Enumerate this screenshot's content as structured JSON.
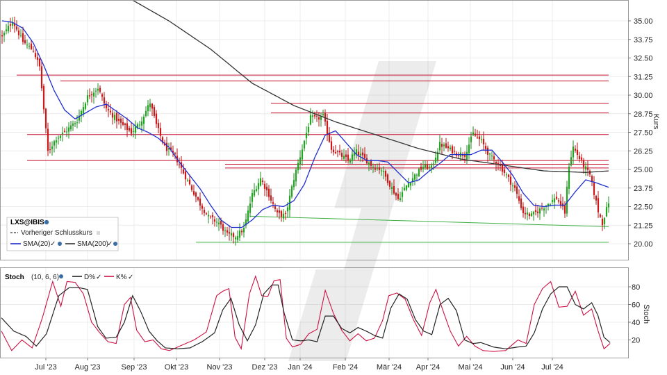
{
  "chart_data": [
    {
      "type": "candlestick",
      "symbol": "LXS@IBIS",
      "ylabel": "Kurs",
      "ylim": [
        19.2,
        35.9
      ],
      "yticks": [
        "35.00",
        "33.75",
        "32.50",
        "31.25",
        "30.00",
        "28.75",
        "27.50",
        "26.25",
        "25.00",
        "23.75",
        "22.50",
        "21.25",
        "20.00"
      ],
      "xticks": [
        "Jul '23",
        "Aug '23",
        "Sep '23",
        "Okt '23",
        "Nov '23",
        "Dez '23",
        "Jan '24",
        "Feb '24",
        "Mär '24",
        "Apr '24",
        "Mai '24",
        "Jun '24",
        "Jul '24"
      ],
      "legend": {
        "symbol": "LXS@IBIS",
        "prev_close": "Vorheriger Schlusskurs",
        "sma20": "SMA(20)",
        "sma200": "SMA(200)"
      },
      "close_anchors": [
        [
          0,
          33.9
        ],
        [
          5,
          35.0
        ],
        [
          10,
          33.6
        ],
        [
          15,
          33.0
        ],
        [
          18,
          31.9
        ],
        [
          22,
          26.2
        ],
        [
          26,
          27.1
        ],
        [
          30,
          27.5
        ],
        [
          36,
          28.3
        ],
        [
          41,
          29.9
        ],
        [
          46,
          30.5
        ],
        [
          50,
          29.1
        ],
        [
          56,
          28.2
        ],
        [
          62,
          27.5
        ],
        [
          66,
          28.1
        ],
        [
          71,
          29.5
        ],
        [
          74,
          28.0
        ],
        [
          78,
          26.5
        ],
        [
          83,
          25.9
        ],
        [
          88,
          24.5
        ],
        [
          94,
          22.9
        ],
        [
          99,
          21.8
        ],
        [
          104,
          21.4
        ],
        [
          108,
          20.6
        ],
        [
          112,
          20.5
        ],
        [
          116,
          21.0
        ],
        [
          120,
          23.3
        ],
        [
          124,
          24.4
        ],
        [
          128,
          23.3
        ],
        [
          132,
          22.0
        ],
        [
          136,
          21.9
        ],
        [
          140,
          24.4
        ],
        [
          144,
          26.4
        ],
        [
          148,
          28.5
        ],
        [
          151,
          28.4
        ],
        [
          154,
          28.6
        ],
        [
          158,
          26.4
        ],
        [
          162,
          26.0
        ],
        [
          166,
          25.6
        ],
        [
          170,
          26.2
        ],
        [
          174,
          25.7
        ],
        [
          178,
          25.2
        ],
        [
          182,
          25.0
        ],
        [
          186,
          24.0
        ],
        [
          190,
          23.0
        ],
        [
          194,
          23.9
        ],
        [
          198,
          24.6
        ],
        [
          202,
          25.2
        ],
        [
          206,
          25.1
        ],
        [
          210,
          26.7
        ],
        [
          214,
          26.4
        ],
        [
          218,
          26.1
        ],
        [
          222,
          26.0
        ],
        [
          226,
          27.4
        ],
        [
          230,
          26.9
        ],
        [
          234,
          25.9
        ],
        [
          238,
          25.4
        ],
        [
          242,
          24.6
        ],
        [
          246,
          23.7
        ],
        [
          250,
          22.1
        ],
        [
          254,
          21.9
        ],
        [
          258,
          22.3
        ],
        [
          262,
          22.7
        ],
        [
          266,
          23.1
        ],
        [
          270,
          22.1
        ],
        [
          272,
          25.3
        ],
        [
          274,
          26.5
        ],
        [
          278,
          25.5
        ],
        [
          282,
          24.6
        ],
        [
          286,
          22.2
        ],
        [
          288,
          21.4
        ],
        [
          291,
          22.8
        ]
      ],
      "sma20_anchors": [
        [
          0,
          35.0
        ],
        [
          5,
          34.9
        ],
        [
          10,
          34.5
        ],
        [
          15,
          33.5
        ],
        [
          20,
          32.0
        ],
        [
          25,
          30.3
        ],
        [
          30,
          29.0
        ],
        [
          35,
          28.4
        ],
        [
          40,
          28.8
        ],
        [
          45,
          29.2
        ],
        [
          50,
          29.4
        ],
        [
          55,
          28.9
        ],
        [
          60,
          28.4
        ],
        [
          65,
          27.8
        ],
        [
          70,
          27.5
        ],
        [
          75,
          27.1
        ],
        [
          80,
          26.5
        ],
        [
          85,
          25.5
        ],
        [
          90,
          24.6
        ],
        [
          95,
          23.7
        ],
        [
          100,
          22.6
        ],
        [
          105,
          21.6
        ],
        [
          110,
          21.1
        ],
        [
          115,
          21.1
        ],
        [
          120,
          21.6
        ],
        [
          125,
          22.3
        ],
        [
          130,
          22.6
        ],
        [
          135,
          22.5
        ],
        [
          140,
          22.9
        ],
        [
          145,
          24.0
        ],
        [
          150,
          25.8
        ],
        [
          155,
          27.3
        ],
        [
          160,
          27.6
        ],
        [
          165,
          26.8
        ],
        [
          170,
          26.0
        ],
        [
          175,
          25.6
        ],
        [
          180,
          25.6
        ],
        [
          185,
          25.5
        ],
        [
          190,
          24.8
        ],
        [
          195,
          24.1
        ],
        [
          200,
          24.3
        ],
        [
          205,
          24.9
        ],
        [
          210,
          25.4
        ],
        [
          215,
          26.0
        ],
        [
          220,
          26.0
        ],
        [
          225,
          26.0
        ],
        [
          230,
          26.3
        ],
        [
          235,
          26.3
        ],
        [
          240,
          25.5
        ],
        [
          245,
          24.6
        ],
        [
          250,
          23.4
        ],
        [
          255,
          22.6
        ],
        [
          260,
          22.5
        ],
        [
          265,
          22.6
        ],
        [
          270,
          22.6
        ],
        [
          275,
          23.5
        ],
        [
          280,
          24.3
        ],
        [
          285,
          24.1
        ],
        [
          291,
          23.8
        ]
      ],
      "sma200_anchors": [
        [
          60,
          36.6
        ],
        [
          80,
          35.0
        ],
        [
          100,
          33.1
        ],
        [
          120,
          30.8
        ],
        [
          140,
          29.3
        ],
        [
          160,
          28.2
        ],
        [
          180,
          27.3
        ],
        [
          200,
          26.4
        ],
        [
          220,
          25.7
        ],
        [
          240,
          25.3
        ],
        [
          260,
          24.9
        ],
        [
          280,
          24.8
        ],
        [
          291,
          24.9
        ]
      ],
      "horizontal_lines_red": [
        [
          7,
          291,
          31.35
        ],
        [
          28,
          291,
          30.95
        ],
        [
          129,
          291,
          29.45
        ],
        [
          129,
          291,
          28.8
        ],
        [
          12,
          291,
          27.35
        ],
        [
          107,
          291,
          25.35
        ],
        [
          12,
          291,
          25.6
        ],
        [
          107,
          291,
          25.1
        ]
      ],
      "horizontal_lines_green": [
        [
          119,
          291,
          21.85,
          21.15
        ],
        [
          93,
          291,
          20.1,
          20.1
        ]
      ]
    },
    {
      "type": "line",
      "indicator": "Stoch",
      "params": "(10, 6, 6)",
      "ylabel": "Stoch",
      "ylim": [
        5,
        93
      ],
      "yticks": [
        "80",
        "60",
        "40",
        "20"
      ],
      "legend": {
        "d": "D%",
        "k": "K%"
      },
      "d_anchors": [
        [
          0,
          45
        ],
        [
          6,
          30
        ],
        [
          12,
          24
        ],
        [
          17,
          13
        ],
        [
          22,
          27
        ],
        [
          28,
          70
        ],
        [
          33,
          79
        ],
        [
          38,
          79
        ],
        [
          42,
          77
        ],
        [
          47,
          35
        ],
        [
          51,
          22
        ],
        [
          56,
          23
        ],
        [
          60,
          40
        ],
        [
          64,
          70
        ],
        [
          68,
          52
        ],
        [
          72,
          30
        ],
        [
          76,
          19
        ],
        [
          80,
          11
        ],
        [
          86,
          10
        ],
        [
          92,
          11
        ],
        [
          98,
          18
        ],
        [
          104,
          28
        ],
        [
          108,
          54
        ],
        [
          112,
          67
        ],
        [
          116,
          37
        ],
        [
          120,
          19
        ],
        [
          124,
          37
        ],
        [
          128,
          72
        ],
        [
          132,
          82
        ],
        [
          135,
          82
        ],
        [
          138,
          50
        ],
        [
          142,
          20
        ],
        [
          146,
          19
        ],
        [
          150,
          20
        ],
        [
          154,
          18
        ],
        [
          158,
          47
        ],
        [
          162,
          47
        ],
        [
          166,
          33
        ],
        [
          170,
          28
        ],
        [
          174,
          34
        ],
        [
          178,
          30
        ],
        [
          182,
          25
        ],
        [
          186,
          22
        ],
        [
          190,
          56
        ],
        [
          194,
          72
        ],
        [
          198,
          66
        ],
        [
          202,
          43
        ],
        [
          206,
          30
        ],
        [
          210,
          26
        ],
        [
          214,
          60
        ],
        [
          218,
          67
        ],
        [
          222,
          53
        ],
        [
          226,
          20
        ],
        [
          230,
          16
        ],
        [
          234,
          17
        ],
        [
          240,
          12
        ],
        [
          246,
          10
        ],
        [
          252,
          12
        ],
        [
          256,
          13
        ],
        [
          260,
          28
        ],
        [
          264,
          55
        ],
        [
          268,
          72
        ],
        [
          272,
          80
        ],
        [
          276,
          80
        ],
        [
          280,
          60
        ],
        [
          284,
          55
        ],
        [
          288,
          62
        ],
        [
          291,
          48
        ],
        [
          294,
          23
        ],
        [
          297,
          17
        ]
      ],
      "k_anchors": [
        [
          0,
          30
        ],
        [
          5,
          8
        ],
        [
          10,
          20
        ],
        [
          15,
          11
        ],
        [
          20,
          45
        ],
        [
          25,
          86
        ],
        [
          29,
          58
        ],
        [
          32,
          86
        ],
        [
          36,
          85
        ],
        [
          40,
          72
        ],
        [
          44,
          40
        ],
        [
          48,
          28
        ],
        [
          52,
          18
        ],
        [
          56,
          16
        ],
        [
          60,
          60
        ],
        [
          63,
          68
        ],
        [
          66,
          31
        ],
        [
          70,
          18
        ],
        [
          74,
          20
        ],
        [
          78,
          10
        ],
        [
          82,
          8
        ],
        [
          88,
          14
        ],
        [
          94,
          20
        ],
        [
          100,
          29
        ],
        [
          105,
          70
        ],
        [
          108,
          75
        ],
        [
          111,
          78
        ],
        [
          114,
          23
        ],
        [
          117,
          10
        ],
        [
          121,
          72
        ],
        [
          124,
          92
        ],
        [
          127,
          70
        ],
        [
          130,
          69
        ],
        [
          133,
          87
        ],
        [
          136,
          88
        ],
        [
          139,
          22
        ],
        [
          142,
          12
        ],
        [
          146,
          15
        ],
        [
          150,
          27
        ],
        [
          154,
          32
        ],
        [
          158,
          76
        ],
        [
          162,
          50
        ],
        [
          166,
          31
        ],
        [
          170,
          19
        ],
        [
          174,
          27
        ],
        [
          178,
          19
        ],
        [
          182,
          22
        ],
        [
          186,
          42
        ],
        [
          189,
          70
        ],
        [
          193,
          73
        ],
        [
          197,
          66
        ],
        [
          201,
          43
        ],
        [
          205,
          25
        ],
        [
          209,
          62
        ],
        [
          212,
          77
        ],
        [
          215,
          56
        ],
        [
          219,
          30
        ],
        [
          223,
          13
        ],
        [
          227,
          24
        ],
        [
          231,
          13
        ],
        [
          235,
          8
        ],
        [
          240,
          7
        ],
        [
          246,
          8
        ],
        [
          252,
          20
        ],
        [
          256,
          16
        ],
        [
          260,
          60
        ],
        [
          264,
          78
        ],
        [
          268,
          86
        ],
        [
          272,
          57
        ],
        [
          276,
          58
        ],
        [
          280,
          75
        ],
        [
          284,
          48
        ],
        [
          288,
          55
        ],
        [
          291,
          31
        ],
        [
          294,
          10
        ],
        [
          297,
          16
        ]
      ]
    }
  ]
}
